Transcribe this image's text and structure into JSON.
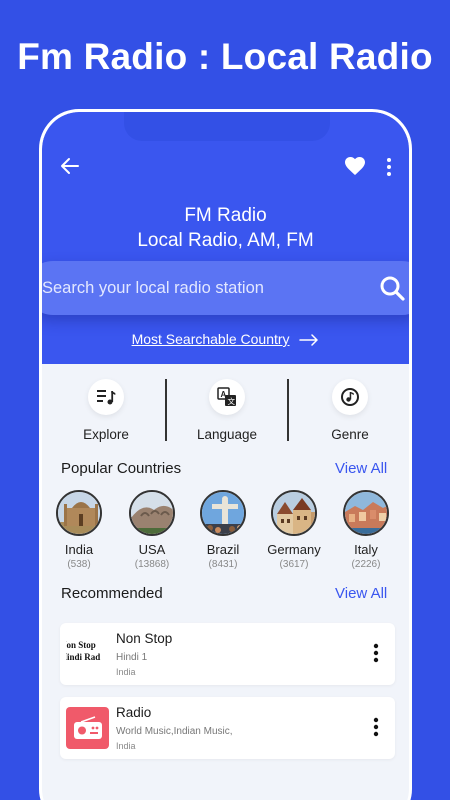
{
  "promo": {
    "title": "Fm Radio : Local Radio"
  },
  "header": {
    "title_line1": "FM Radio",
    "title_line2": "Local Radio, AM, FM"
  },
  "search": {
    "placeholder": "Search your local radio station"
  },
  "most_searchable": {
    "label": "Most Searchable Country"
  },
  "categories": [
    {
      "label": "Explore",
      "icon": "playlist-music-icon"
    },
    {
      "label": "Language",
      "icon": "translate-icon"
    },
    {
      "label": "Genre",
      "icon": "music-disc-icon"
    }
  ],
  "popular": {
    "title": "Popular Countries",
    "view_all": "View All",
    "items": [
      {
        "name": "India",
        "count": "(538)"
      },
      {
        "name": "USA",
        "count": "(13868)"
      },
      {
        "name": "Brazil",
        "count": "(8431)"
      },
      {
        "name": "Germany",
        "count": "(3617)"
      },
      {
        "name": "Italy",
        "count": "(2226)"
      }
    ]
  },
  "recommended": {
    "title": "Recommended",
    "view_all": "View All",
    "items": [
      {
        "name": "Non Stop",
        "genre": "Hindi 1",
        "country": "India",
        "thumb_text_1": "Non Stop",
        "thumb_text_2": "Hindi Rad"
      },
      {
        "name": "Radio",
        "genre": "World Music,Indian Music,",
        "country": "India"
      }
    ]
  },
  "colors": {
    "primary": "#3a56ef",
    "background": "#3350e6",
    "light": "#f1f4fa"
  }
}
